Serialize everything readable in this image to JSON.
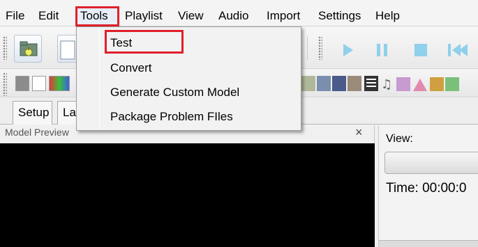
{
  "menubar": {
    "items": [
      {
        "label": "File"
      },
      {
        "label": "Edit"
      },
      {
        "label": "Tools"
      },
      {
        "label": "Playlist"
      },
      {
        "label": "View"
      },
      {
        "label": "Audio"
      },
      {
        "label": "Import"
      },
      {
        "label": "Settings"
      },
      {
        "label": "Help"
      }
    ]
  },
  "tools_menu": {
    "items": [
      {
        "label": "Test"
      },
      {
        "label": "Convert"
      },
      {
        "label": "Generate Custom Model"
      },
      {
        "label": "Package Problem FIles"
      }
    ]
  },
  "tabs": [
    {
      "label": "Setup"
    },
    {
      "label": "La"
    }
  ],
  "model_preview": {
    "title": "Model Preview",
    "close_glyph": "×"
  },
  "right_panel": {
    "view_label": "View:",
    "time_label": "Time: 00:00:0"
  },
  "toolbar": {
    "buttons": [
      "open-folder-icon",
      "new-file-icon",
      "play-icon",
      "pause-icon",
      "stop-icon",
      "rewind-icon"
    ]
  },
  "colors": {
    "highlight_red": "#e0202a",
    "preview_bg": "#000000",
    "accent_blue": "#8fd0ea"
  }
}
